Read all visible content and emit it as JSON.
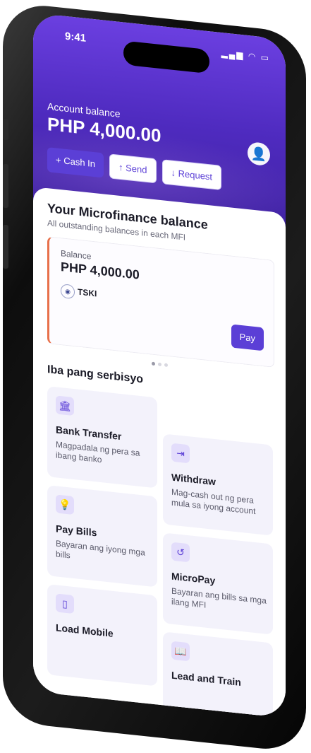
{
  "status": {
    "time": "9:41",
    "icons": "▂▄▆ ◠ ▭"
  },
  "header": {
    "balance_label": "Account balance",
    "balance_value": "PHP 4,000.00"
  },
  "actions": [
    {
      "label": "+ Cash In"
    },
    {
      "label": "↑ Send"
    },
    {
      "label": "↓ Request"
    }
  ],
  "microfinance": {
    "title": "Your Microfinance balance",
    "subtitle": "All outstanding balances in each MFI",
    "card": {
      "label": "Balance",
      "value": "PHP 4,000.00",
      "institution": "TSKI",
      "pay_label": "Pay"
    }
  },
  "services": {
    "title": "Iba pang serbisyo",
    "items": [
      {
        "title": "Bank Transfer",
        "desc": "Magpadala ng pera sa ibang banko",
        "icon": "🏛"
      },
      {
        "title": "Withdraw",
        "desc": "Mag-cash out ng pera mula sa iyong account",
        "icon": "⇥"
      },
      {
        "title": "Pay Bills",
        "desc": "Bayaran ang iyong mga bills",
        "icon": "💡"
      },
      {
        "title": "MicroPay",
        "desc": "Bayaran ang bills sa mga ilang MFI",
        "icon": "↺"
      },
      {
        "title": "Load Mobile",
        "desc": "",
        "icon": "▯"
      },
      {
        "title": "Lead and Train",
        "desc": "",
        "icon": "📖"
      }
    ]
  },
  "colors": {
    "accent": "#5b3fd6",
    "header": "#4f2bc0",
    "card_accent": "#e8704a"
  }
}
